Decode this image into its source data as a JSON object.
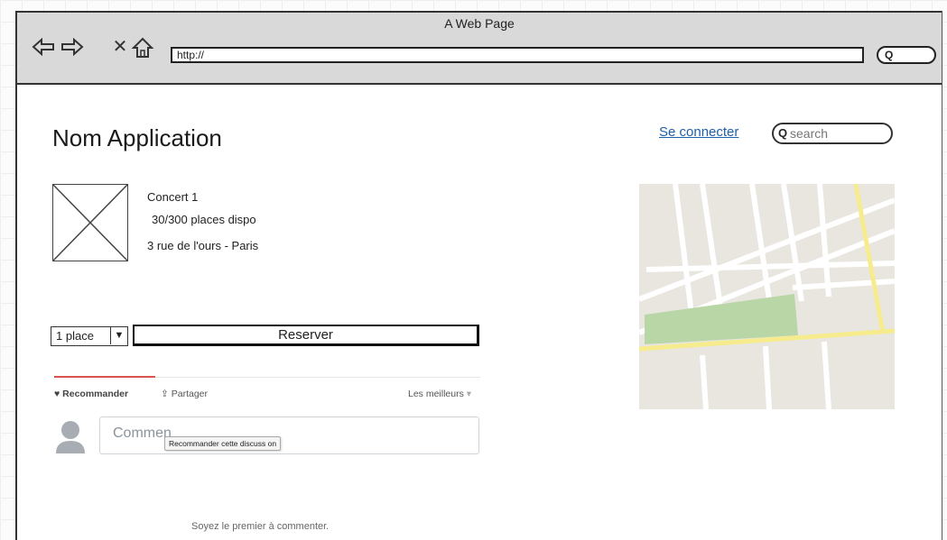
{
  "browser": {
    "title": "A Web Page",
    "address": "http://",
    "back_icon": "arrow-left-icon",
    "forward_icon": "arrow-right-icon",
    "stop_icon": "close-icon",
    "home_icon": "home-icon"
  },
  "header": {
    "app_name": "Nom Application",
    "login_label": "Se connecter",
    "search_placeholder": "search"
  },
  "event": {
    "name": "Concert 1",
    "availability": "30/300 places dispo",
    "address": "3 rue de l'ours - Paris"
  },
  "booking": {
    "quantity_selected": "1 place",
    "reserve_label": "Reserver"
  },
  "comments": {
    "recommend_label": "Recommander",
    "share_label": "Partager",
    "sort_label": "Les meilleurs",
    "input_placeholder": "Commen",
    "tooltip": "Recommander cette discuss on",
    "empty_message": "Soyez le premier à commenter."
  },
  "colors": {
    "link": "#1d5fa8",
    "accent_line": "#d9534f",
    "map_road_highlight": "#f6ec8e",
    "map_park": "#b9d7a6",
    "map_background": "#e9e6e0"
  }
}
